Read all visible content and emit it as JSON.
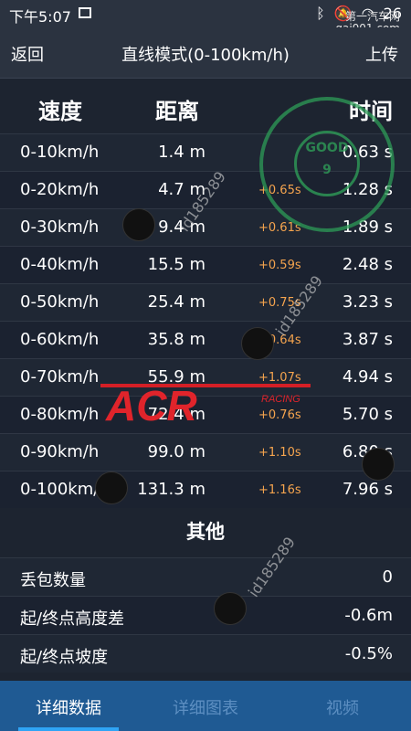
{
  "status_bar": {
    "time": "下午5:07",
    "battery": "26",
    "site": "第一汽车网",
    "site_url": "gai001.com"
  },
  "app_bar": {
    "back_label": "返回",
    "title": "直线模式(0-100km/h)",
    "upload_label": "上传"
  },
  "table": {
    "headers": {
      "speed": "速度",
      "distance": "距离",
      "time": "时间"
    },
    "rows": [
      {
        "speed": "0-10km/h",
        "distance": "1.4 m",
        "delta": "",
        "time": "0.63 s"
      },
      {
        "speed": "0-20km/h",
        "distance": "4.7 m",
        "delta": "+0.65s",
        "time": "1.28 s"
      },
      {
        "speed": "0-30km/h",
        "distance": "9.4 m",
        "delta": "+0.61s",
        "time": "1.89 s"
      },
      {
        "speed": "0-40km/h",
        "distance": "15.5 m",
        "delta": "+0.59s",
        "time": "2.48 s"
      },
      {
        "speed": "0-50km/h",
        "distance": "25.4 m",
        "delta": "+0.75s",
        "time": "3.23 s"
      },
      {
        "speed": "0-60km/h",
        "distance": "35.8 m",
        "delta": "+0.64s",
        "time": "3.87 s"
      },
      {
        "speed": "0-70km/h",
        "distance": "55.9 m",
        "delta": "+1.07s",
        "time": "4.94 s"
      },
      {
        "speed": "0-80km/h",
        "distance": "72.4 m",
        "delta": "+0.76s",
        "time": "5.70 s"
      },
      {
        "speed": "0-90km/h",
        "distance": "99.0 m",
        "delta": "+1.10s",
        "time": "6.80 s"
      },
      {
        "speed": "0-100km/h",
        "distance": "131.3 m",
        "delta": "+1.16s",
        "time": "7.96 s"
      }
    ]
  },
  "other": {
    "title": "其他",
    "rows": [
      {
        "label": "丢包数量",
        "value": "0"
      },
      {
        "label": "起/终点高度差",
        "value": "-0.6m"
      },
      {
        "label": "起/终点坡度",
        "value": "-0.5%"
      }
    ]
  },
  "tabs": [
    {
      "label": "详细数据",
      "active": true
    },
    {
      "label": "详细图表",
      "active": false
    },
    {
      "label": "视频",
      "active": false
    }
  ],
  "watermarks": {
    "stamp_text": "GOOD",
    "stamp_number": "9",
    "id_text": "id185289",
    "brand": "ACR",
    "brand_sub": "RACING"
  },
  "colors": {
    "background": "#1d2430",
    "header": "#2b3340",
    "delta": "#f5a44e",
    "tab_bar": "#1f5a93",
    "tab_indicator": "#2fa4f5"
  }
}
